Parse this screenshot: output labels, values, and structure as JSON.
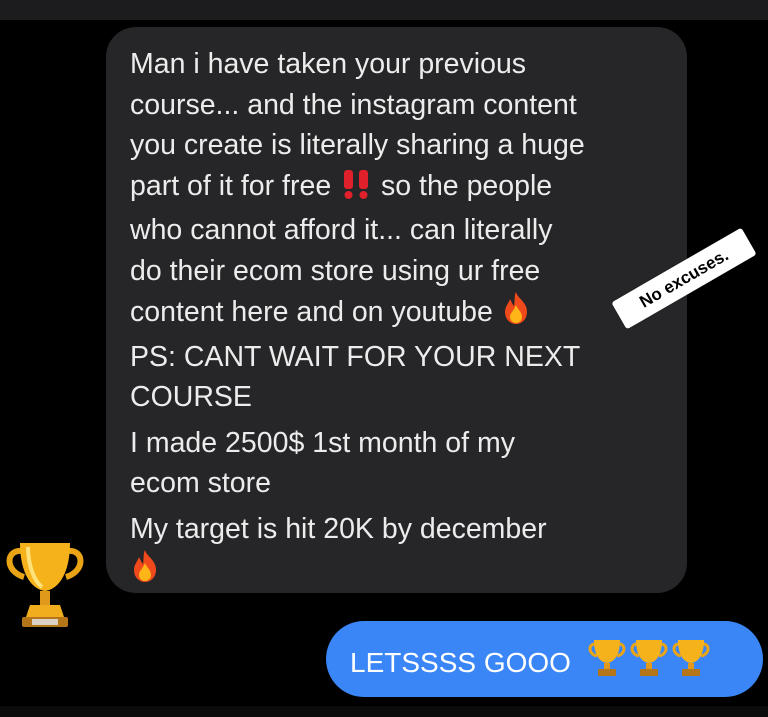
{
  "incoming_message": {
    "lines": [
      "Man i have taken your previous",
      "course... and the instagram content",
      "you create is literally sharing a huge",
      "part of it for free",
      "so the people",
      "who cannot afford it... can literally",
      "do their ecom store using ur free",
      "content here and on youtube",
      "PS: CANT WAIT FOR YOUR NEXT",
      "COURSE",
      "I made 2500$ 1st month of my",
      "ecom store",
      "My target is hit 20K by december"
    ]
  },
  "sticker": {
    "text": "No excuses."
  },
  "reaction": {
    "icon": "trophy-icon"
  },
  "outgoing_message": {
    "text": "LETSSSS GOOO",
    "emoji_icons": [
      "trophy-icon",
      "trophy-icon",
      "trophy-icon"
    ]
  },
  "colors": {
    "incoming_bubble": "#262628",
    "outgoing_bubble": "#3a86f7",
    "background": "#000000"
  }
}
